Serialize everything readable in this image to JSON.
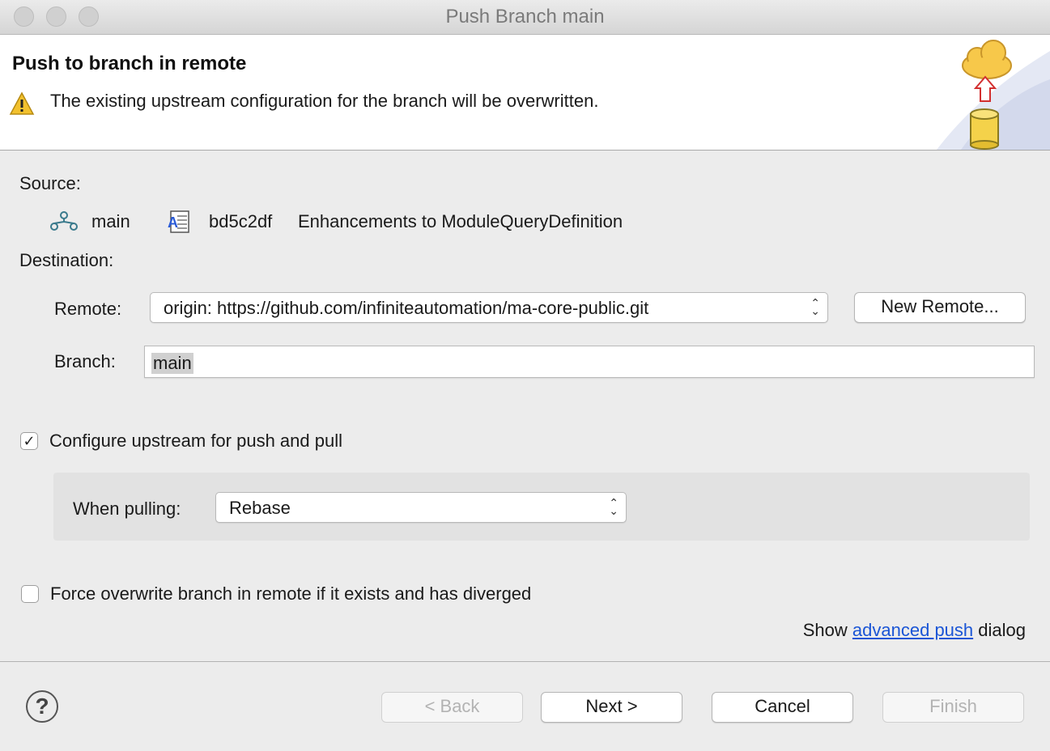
{
  "window": {
    "title": "Push Branch main"
  },
  "header": {
    "title": "Push to branch in remote",
    "message": "The existing upstream configuration for the branch will be overwritten."
  },
  "source": {
    "label": "Source:",
    "branch": "main",
    "commit_id": "bd5c2df",
    "commit_message": "Enhancements to ModuleQueryDefinition"
  },
  "destination": {
    "label": "Destination:",
    "remote_label": "Remote:",
    "remote_value": "origin: https://github.com/infiniteautomation/ma-core-public.git",
    "new_remote_button": "New Remote...",
    "branch_label": "Branch:",
    "branch_value": "main"
  },
  "upstream": {
    "checkbox_label": "Configure upstream for push and pull",
    "checked": true,
    "when_pulling_label": "When pulling:",
    "when_pulling_value": "Rebase"
  },
  "force": {
    "checkbox_label": "Force overwrite branch in remote if it exists and has diverged",
    "checked": false
  },
  "advanced": {
    "prefix": "Show",
    "link": "advanced push",
    "suffix": "dialog"
  },
  "buttons": {
    "back": "< Back",
    "next": "Next >",
    "cancel": "Cancel",
    "finish": "Finish"
  },
  "icons": {
    "help": "?",
    "check": "✓"
  },
  "colors": {
    "link": "#1a55d6",
    "warning": "#f2c12e",
    "cloud": "#f7c84a",
    "arrow": "#d22f2f"
  }
}
